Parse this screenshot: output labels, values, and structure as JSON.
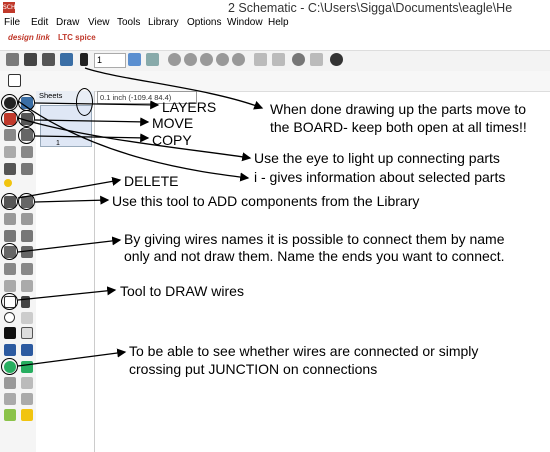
{
  "window": {
    "title": "2 Schematic - C:\\Users\\Sigga\\Documents\\eagle\\He",
    "app_icon_text": "SCH"
  },
  "menu": {
    "items": [
      "File",
      "Edit",
      "Draw",
      "View",
      "Tools",
      "Library",
      "Options",
      "Window",
      "Help"
    ]
  },
  "toolbar": {
    "logo_left": "design link",
    "logo_right": "LTC spice",
    "zoom_value": "1",
    "icons": [
      "save-icon",
      "print-icon",
      "cam-icon",
      "board-switch-icon",
      "grid-icon",
      "zoom-fit-icon",
      "zoom-in-icon",
      "zoom-out-icon",
      "zoom-select-icon",
      "undo-icon",
      "redo-icon",
      "stop-icon",
      "go-icon",
      "help-icon"
    ]
  },
  "panel": {
    "sheets_label": "Sheets",
    "coordinate_readout": "0.1 inch (-109.4 84.4)",
    "sheet_number": "1"
  },
  "annotations": {
    "layers": "LAYERS",
    "move": "MOVE",
    "copy": "COPY",
    "board_line1": "When done drawing up the parts move to",
    "board_line2": "the BOARD- keep both open at all times!!",
    "eye_line1": "Use the eye to light up connecting parts",
    "eye_line2": "i - gives information about selected parts",
    "delete": "DELETE",
    "add": "Use this tool to ADD components from the Library",
    "name_line1": "By giving wires names it is possible to connect them by name",
    "name_line2": "only and not draw them.  Name the ends you want to connect.",
    "wire": "Tool to DRAW wires",
    "junction_line1": "To be able to see whether wires are connected or simply",
    "junction_line2": "crossing put JUNCTION on connections"
  },
  "colors": {
    "accent": "#c0392b",
    "arrow": "#000000"
  }
}
